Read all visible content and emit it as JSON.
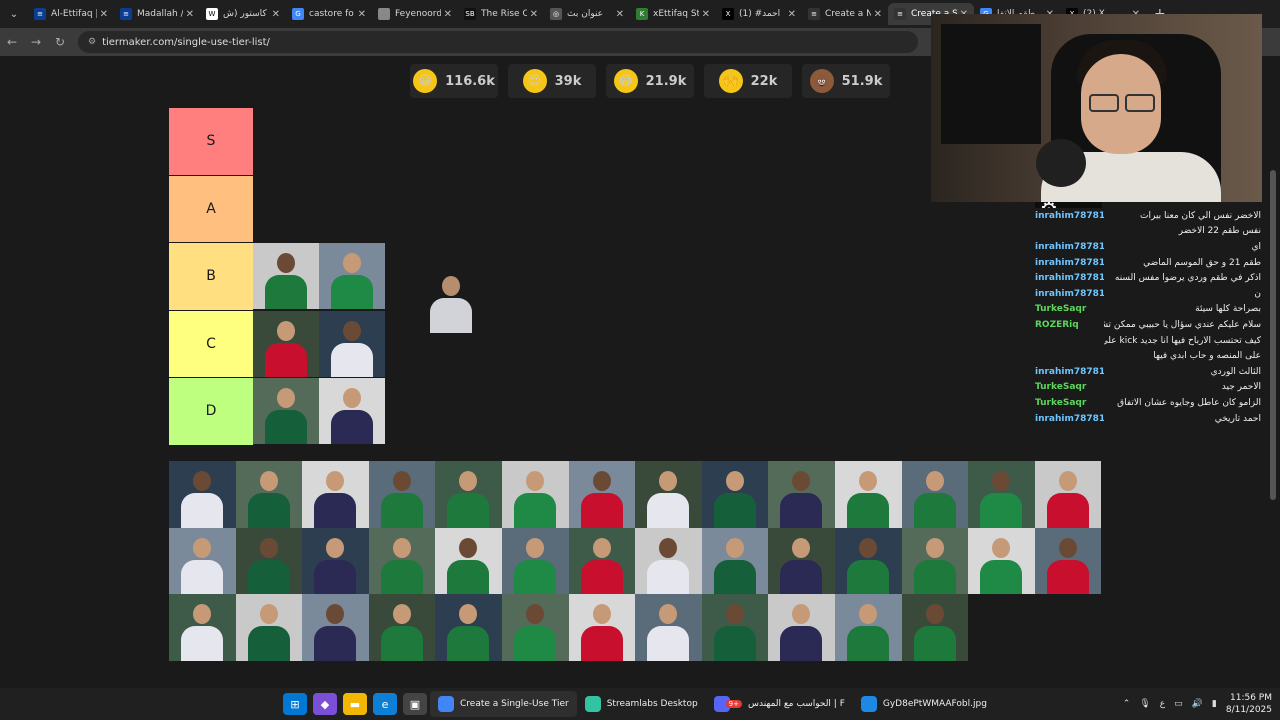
{
  "browser": {
    "tabs": [
      {
        "title": "Al-Ettifaq |",
        "color": "#0b3d91",
        "glyph": "≡"
      },
      {
        "title": "Madallah /",
        "color": "#0b3d91",
        "glyph": "≡"
      },
      {
        "title": "كاستور (ش",
        "color": "#ffffff",
        "glyph": "W"
      },
      {
        "title": "castore fo",
        "color": "#4285f4",
        "glyph": "G"
      },
      {
        "title": "Feyenoord",
        "color": "#888888",
        "glyph": ""
      },
      {
        "title": "The Rise O",
        "color": "#111111",
        "glyph": "SB"
      },
      {
        "title": "عنوان بث",
        "color": "#555555",
        "glyph": "◎"
      },
      {
        "title": "xEttifaq St",
        "color": "#2e7d32",
        "glyph": "K"
      },
      {
        "title": "أحمد# (1)",
        "color": "#000000",
        "glyph": "X"
      },
      {
        "title": "Create a N",
        "color": "#333333",
        "glyph": "≡"
      },
      {
        "title": "Create a S",
        "color": "#333333",
        "glyph": "≡"
      },
      {
        "title": "طقم الاتفا",
        "color": "#4285f4",
        "glyph": "G"
      },
      {
        "title": "(2) X",
        "color": "#000000",
        "glyph": "X"
      }
    ],
    "active_tab": 10,
    "new_tab": "+",
    "url": "tiermaker.com/single-use-tier-list/"
  },
  "reactions": [
    {
      "emoji": "😀",
      "count": "116.6k",
      "color": "#f5c518"
    },
    {
      "emoji": "😍",
      "count": "39k",
      "color": "#f5c518"
    },
    {
      "emoji": "😂",
      "count": "21.9k",
      "color": "#f5c518"
    },
    {
      "emoji": "🙌",
      "count": "22k",
      "color": "#f5c518"
    },
    {
      "emoji": "💩",
      "count": "51.9k",
      "color": "#8d5a3a"
    }
  ],
  "tiers": [
    {
      "label": "S",
      "color": "#ff7f7f",
      "items": 0
    },
    {
      "label": "A",
      "color": "#ffbf7f",
      "items": 0
    },
    {
      "label": "B",
      "color": "#ffdf7f",
      "items": 2
    },
    {
      "label": "C",
      "color": "#ffff7f",
      "items": 2
    },
    {
      "label": "D",
      "color": "#bfff7f",
      "items": 2
    }
  ],
  "pool_count": 40,
  "chat": [
    {
      "user": "inrahim787815",
      "msg": "الاخضر نفس الي كان معنا بيرات",
      "green": false
    },
    {
      "user": "",
      "msg": "نفس طقم 22 الاخضر",
      "green": false
    },
    {
      "user": "inrahim787815",
      "msg": "اي",
      "green": false
    },
    {
      "user": "inrahim787815",
      "msg": "طقم 21 و حق الموسم الماضي",
      "green": false
    },
    {
      "user": "inrahim787815",
      "msg": "اذكر في طقم وردي يرضوا مفس السنه",
      "green": false
    },
    {
      "user": "inrahim787815",
      "msg": "ن",
      "green": false
    },
    {
      "user": "TurkeSaqr",
      "msg": "بصراحة كلها سيئة",
      "green": true
    },
    {
      "user": "ROZERiq",
      "msg": "سلام عليكم عندي سؤال يا حبيبي ممكن تشرحلي :",
      "green": true
    },
    {
      "user": "",
      "msg": "كيف تحتسب الارباح فيها انا جديد kick على منصة",
      "green": false
    },
    {
      "user": "",
      "msg": "على المنصه و حاب ابدي فيها",
      "green": false
    },
    {
      "user": "inrahim787815",
      "msg": "الثالث الوردي",
      "green": false
    },
    {
      "user": "TurkeSaqr",
      "msg": "الاحمر جيد",
      "green": true
    },
    {
      "user": "TurkeSaqr",
      "msg": "الزامو كان عاطل وجايوه عشان الاتفاق",
      "green": true
    },
    {
      "user": "inrahim787815",
      "msg": "احمد تاريخي",
      "green": false
    }
  ],
  "taskbar": {
    "apps": [
      {
        "label": "Create a Single-Use Tier",
        "active": true,
        "color": "#4285f4"
      },
      {
        "label": "Streamlabs Desktop",
        "active": false,
        "color": "#31c3a2"
      },
      {
        "label": "الحواسب مع المهندس | F",
        "active": false,
        "color": "#5865f2"
      },
      {
        "label": "GyD8ePtWMAAFobl.jpg",
        "active": false,
        "color": "#1e88e5"
      }
    ],
    "tray_lang": "ع",
    "time": "11:56 PM",
    "date": "8/11/2025",
    "discord_badge": "9+"
  }
}
